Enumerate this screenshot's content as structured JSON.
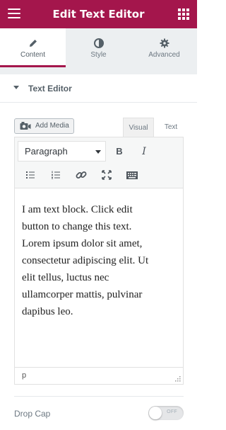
{
  "header": {
    "title": "Edit Text Editor",
    "menu_icon": "hamburger-menu-icon",
    "apps_icon": "grid-apps-icon"
  },
  "tabs": [
    {
      "label": "Content",
      "icon": "pencil-icon",
      "active": true
    },
    {
      "label": "Style",
      "icon": "contrast-circle-icon",
      "active": false
    },
    {
      "label": "Advanced",
      "icon": "gear-icon",
      "active": false
    }
  ],
  "section": {
    "label": "Text Editor",
    "icon": "caret-down-icon"
  },
  "media": {
    "add_label": "Add Media",
    "icon": "media-camera-icon"
  },
  "modes": {
    "visual": "Visual",
    "text": "Text",
    "selected": "Visual"
  },
  "toolbar": {
    "format_select": "Paragraph",
    "bold": "B",
    "italic": "I",
    "buttons": [
      "bulleted-list-icon",
      "numbered-list-icon",
      "link-icon",
      "fullscreen-icon",
      "keyboard-toolbar-icon"
    ]
  },
  "editor": {
    "lines": [
      "I am text block. Click edit",
      "button to change this text.",
      "Lorem ipsum dolor sit amet,",
      "consectetur adipiscing elit. Ut",
      "elit tellus, luctus nec",
      "ullamcorper mattis, pulvinar",
      "dapibus leo."
    ],
    "path": "p"
  },
  "drop_cap": {
    "label": "Drop Cap",
    "state": "OFF",
    "enabled": false
  },
  "colors": {
    "brand": "#a4164c",
    "panel_bg": "#eceff1",
    "text": "#6d7882"
  }
}
